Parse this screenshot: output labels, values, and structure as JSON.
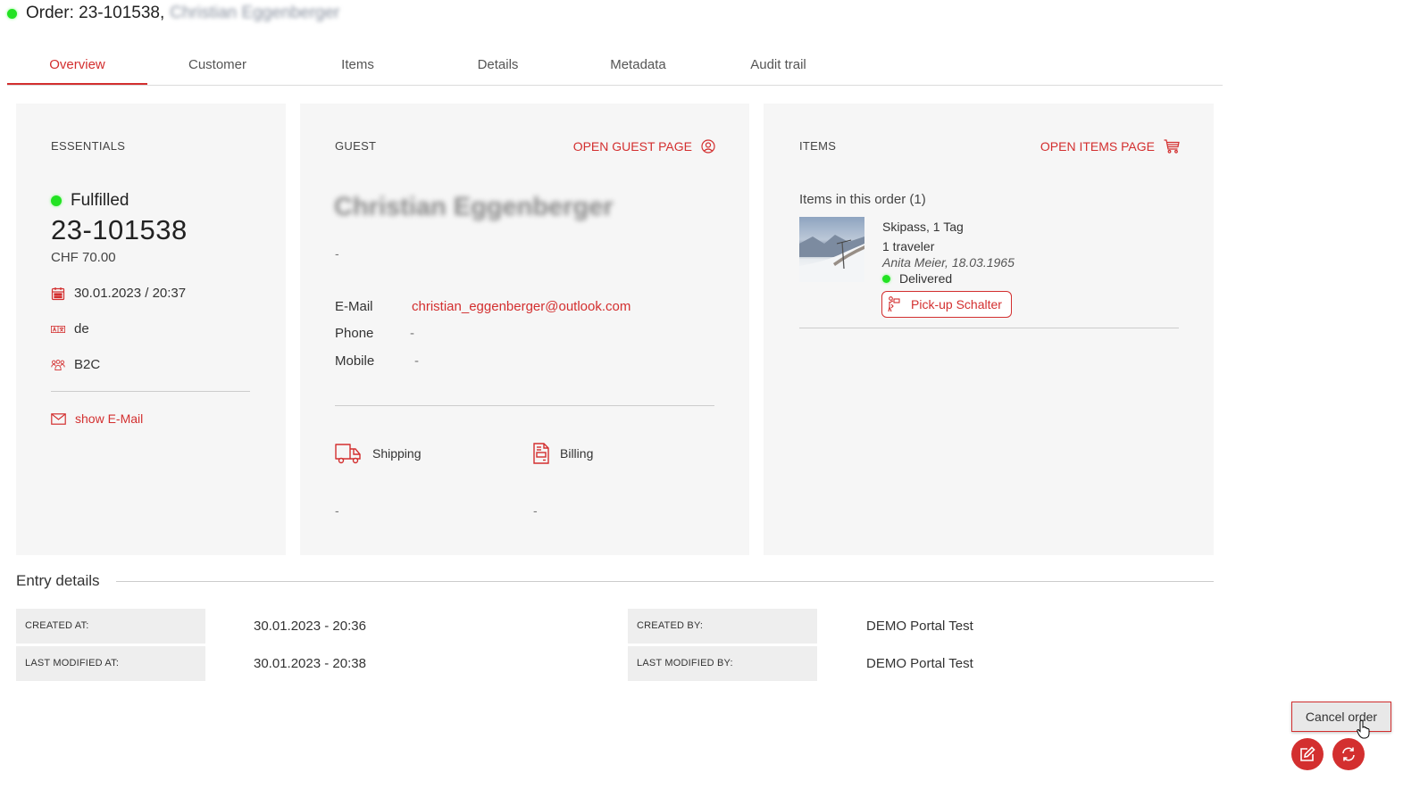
{
  "header": {
    "status_color": "#22e222",
    "title": "Order: 23-101538,",
    "customer_name_redacted": "Christian Eggenberger"
  },
  "tabs": [
    {
      "label": "Overview",
      "active": true
    },
    {
      "label": "Customer",
      "active": false
    },
    {
      "label": "Items",
      "active": false
    },
    {
      "label": "Details",
      "active": false
    },
    {
      "label": "Metadata",
      "active": false
    },
    {
      "label": "Audit trail",
      "active": false
    }
  ],
  "essentials": {
    "heading": "ESSENTIALS",
    "status": "Fulfilled",
    "order_number": "23-101538",
    "price": "CHF 70.00",
    "date": "30.01.2023 / 20:37",
    "language": "de",
    "segment": "B2C",
    "show_email_label": "show E-Mail",
    "icons": {
      "date": "calendar-icon",
      "language": "language-icon",
      "segment": "group-icon",
      "email": "envelope-icon"
    }
  },
  "guest": {
    "heading": "GUEST",
    "open_link": "OPEN GUEST PAGE",
    "open_link_icon": "user-circle-icon",
    "name": "Christian Eggenberger",
    "subtitle": "-",
    "contacts": [
      {
        "label": "E-Mail",
        "value": "christian_eggenberger@outlook.com"
      },
      {
        "label": "Phone",
        "value": "-"
      },
      {
        "label": "Mobile",
        "value": "-"
      }
    ],
    "shipping": {
      "label": "Shipping",
      "value": "-",
      "icon": "truck-icon"
    },
    "billing": {
      "label": "Billing",
      "value": "-",
      "icon": "invoice-icon"
    }
  },
  "items": {
    "heading": "ITEMS",
    "open_link": "OPEN ITEMS PAGE",
    "open_link_icon": "cart-icon",
    "count_label": "Items in this order (1)",
    "list": [
      {
        "name": "Skipass, 1 Tag",
        "travelers": "1 traveler",
        "traveler_detail": "Anita Meier, 18.03.1965",
        "status": "Delivered",
        "pickup_label": "Pick-up Schalter"
      }
    ]
  },
  "entry_details": {
    "heading": "Entry details",
    "created_at_label": "CREATED AT:",
    "created_at": "30.01.2023 - 20:36",
    "modified_at_label": "LAST MODIFIED AT:",
    "modified_at": "30.01.2023 - 20:38",
    "created_by_label": "CREATED BY:",
    "created_by": "DEMO Portal Test",
    "modified_by_label": "LAST MODIFIED BY:",
    "modified_by": "DEMO Portal Test"
  },
  "actions": {
    "cancel_label": "Cancel order",
    "edit_icon": "edit-icon",
    "refresh_icon": "refresh-icon"
  },
  "colors": {
    "accent": "#d32f2f",
    "status_green": "#22e222",
    "card_bg": "#f6f6f6"
  }
}
